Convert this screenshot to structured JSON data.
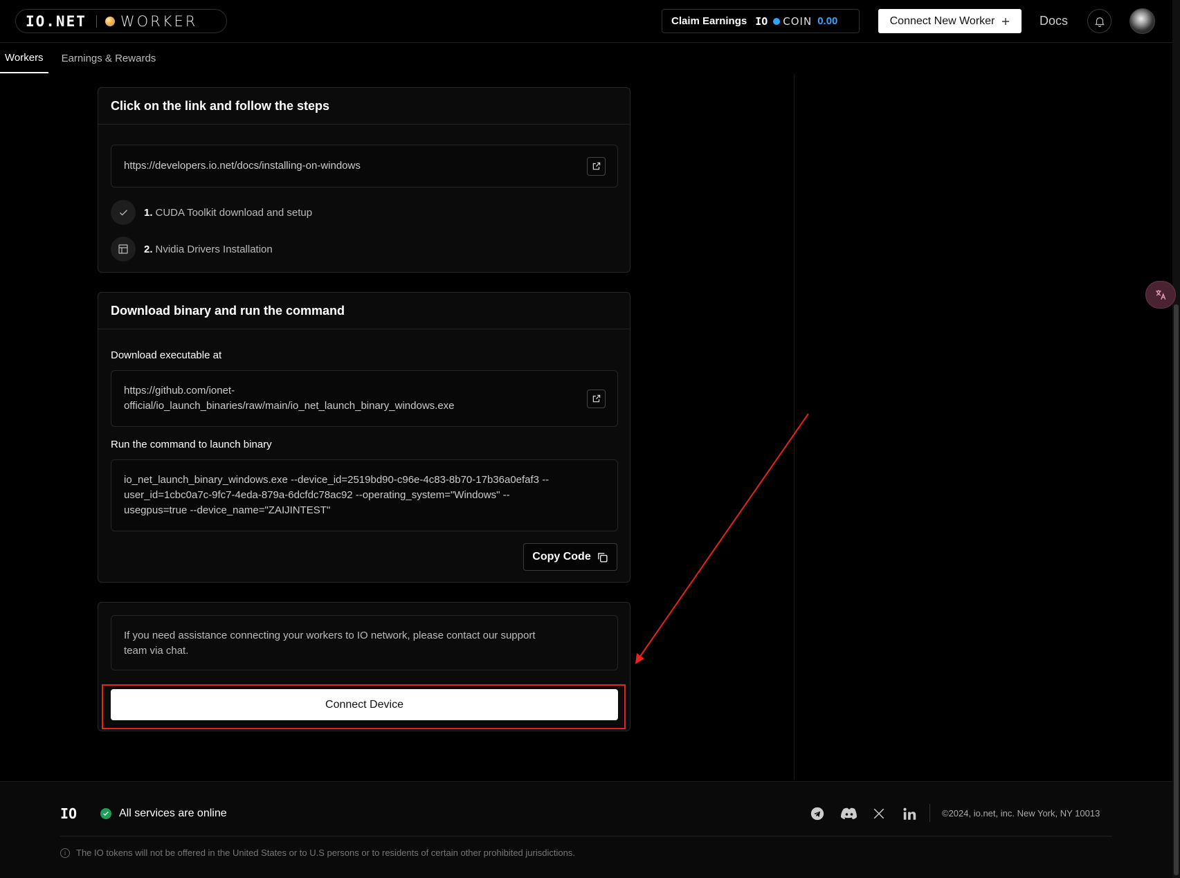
{
  "header": {
    "logo": "IO.NET",
    "product": "WORKER",
    "claim_label": "Claim Earnings",
    "coin_logo": "IO",
    "coin_word": "COIN",
    "coin_value": "0.00",
    "connect_new_label": "Connect New Worker",
    "docs_label": "Docs"
  },
  "tabs": [
    {
      "label": "Workers",
      "active": true
    },
    {
      "label": "Earnings & Rewards",
      "active": false
    }
  ],
  "steps_card": {
    "title": "Click on the link and follow the steps",
    "link": "https://developers.io.net/docs/installing-on-windows",
    "steps": [
      {
        "num": "1.",
        "label": "CUDA Toolkit download and setup",
        "icon": "check-icon"
      },
      {
        "num": "2.",
        "label": "Nvidia Drivers Installation",
        "icon": "layout-icon"
      }
    ]
  },
  "binary_card": {
    "title": "Download binary and run the command",
    "download_label": "Download executable at",
    "download_link_line1": "https://github.com/ionet-",
    "download_link_line2": "official/io_launch_binaries/raw/main/io_net_launch_binary_windows.exe",
    "run_label": "Run the command to launch binary",
    "command_line1": "io_net_launch_binary_windows.exe --device_id=2519bd90-c96e-4c83-8b70-17b36a0efaf3 --",
    "command_line2": "user_id=1cbc0a7c-9fc7-4eda-879a-6dcfdc78ac92 --operating_system=\"Windows\" --",
    "command_line3": "usegpus=true --device_name=\"ZAIJINTEST\"",
    "copy_label": "Copy Code"
  },
  "connect_card": {
    "assist_line1": "If you need assistance connecting your workers to IO network, please contact our support",
    "assist_line2": "team via chat.",
    "connect_label": "Connect Device"
  },
  "translate_icon": "translate-icon",
  "footer": {
    "logo": "IO",
    "status": "All services are online",
    "copyright": "©2024, io.net, inc. New York, NY 10013",
    "note": "The IO tokens will not be offered in the United States or to U.S persons or to residents of certain other prohibited jurisdictions.",
    "socials": [
      "telegram-icon",
      "discord-icon",
      "x-icon",
      "linkedin-icon"
    ]
  },
  "colors": {
    "accent_blue": "#3aa4ff",
    "annotation_red": "#e8221f",
    "status_green": "#1f9d55"
  }
}
